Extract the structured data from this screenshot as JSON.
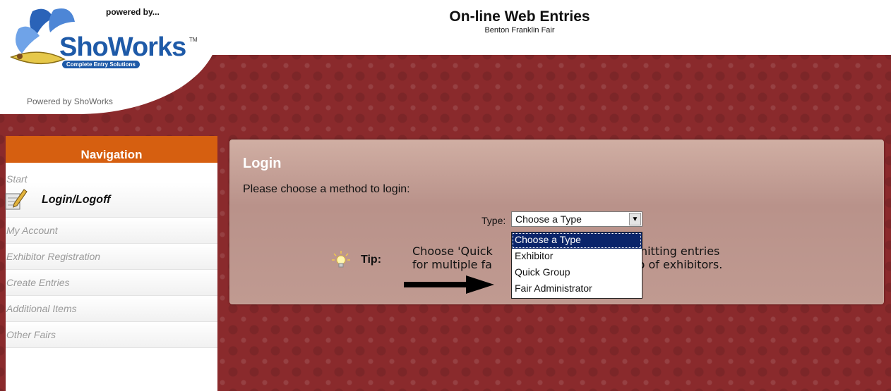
{
  "brand": {
    "powered_by": "powered by...",
    "logo_word": "ShoWorks",
    "logo_tagline": "Complete Entry Solutions",
    "caption": "Powered by ShoWorks"
  },
  "header": {
    "title": "On-line Web Entries",
    "subtitle": "Benton Franklin Fair"
  },
  "nav": {
    "heading": "Navigation",
    "items": [
      {
        "label": "Start"
      },
      {
        "label": "Login/Logoff"
      },
      {
        "label": "My Account"
      },
      {
        "label": "Exhibitor Registration"
      },
      {
        "label": "Create Entries"
      },
      {
        "label": "Additional Items"
      },
      {
        "label": "Other Fairs"
      }
    ]
  },
  "login": {
    "title": "Login",
    "prompt": "Please choose a method to login:",
    "type_label": "Type:",
    "selected": "Choose a Type",
    "options": [
      "Choose a Type",
      "Exhibitor",
      "Quick Group",
      "Fair Administrator"
    ],
    "tip_label": "Tip:",
    "tip_line1": "Choose 'Quick",
    "tip_line1_tail": "be submitting entries",
    "tip_line2": "for multiple fa",
    "tip_line2_tail": "group of exhibitors."
  },
  "colors": {
    "backdrop": "#8a2a2c",
    "nav_header": "#d65f10",
    "dropdown_highlight": "#0a246a"
  }
}
